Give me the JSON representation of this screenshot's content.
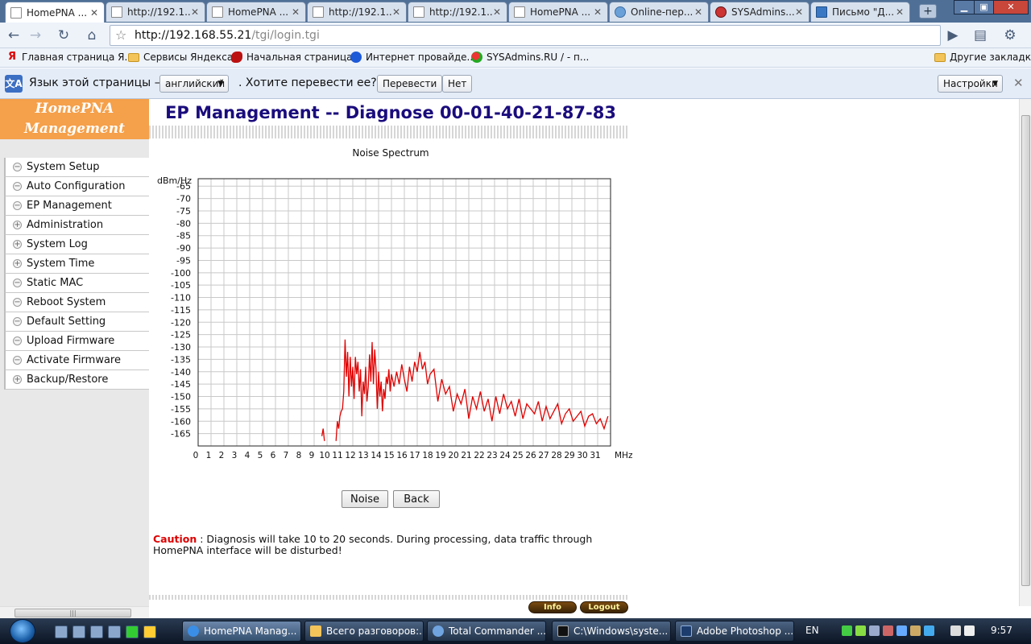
{
  "browser": {
    "tabs": [
      {
        "title": "HomePNA ...",
        "icon": "page-icon",
        "active": true
      },
      {
        "title": "http://192.1...",
        "icon": "page-icon"
      },
      {
        "title": "HomePNA ...",
        "icon": "page-icon"
      },
      {
        "title": "http://192.1...",
        "icon": "page-icon"
      },
      {
        "title": "http://192.1...",
        "icon": "page-icon"
      },
      {
        "title": "HomePNA ...",
        "icon": "page-icon"
      },
      {
        "title": "Online-пер...",
        "icon": "globe-icon"
      },
      {
        "title": "SYSAdmins....",
        "icon": "sysadmins-icon"
      },
      {
        "title": "Письмо \"Д...",
        "icon": "mail-icon"
      }
    ],
    "new_tab": "+",
    "url_host": "http://192.168.55.21",
    "url_path": "/tgi/login.tgi",
    "bookmarks": [
      {
        "label": "Главная страница Я...",
        "icon": "yandex-icon"
      },
      {
        "label": "Сервисы Яндекса",
        "icon": "folder-icon"
      },
      {
        "label": "Начальная страница",
        "icon": "bird-icon"
      },
      {
        "label": "Интернет провайде...",
        "icon": "provider-icon"
      },
      {
        "label": "SYSAdmins.RU / - п...",
        "icon": "sysadmins-icon"
      }
    ],
    "other_bookmarks": "Другие закладки"
  },
  "translate": {
    "prefix": "Язык этой страницы –",
    "language": "английский",
    "question": ". Хотите перевести ее?",
    "translate_btn": "Перевести",
    "no_btn": "Нет",
    "settings_btn": "Настройки"
  },
  "nav": {
    "logo_line1": "HomePNA",
    "logo_line2": "Management",
    "items": [
      {
        "label": "System Setup",
        "sign": "−"
      },
      {
        "label": "Auto Configuration",
        "sign": "−"
      },
      {
        "label": "EP Management",
        "sign": "−"
      },
      {
        "label": "Administration",
        "sign": "+"
      },
      {
        "label": "System Log",
        "sign": "+"
      },
      {
        "label": "System Time",
        "sign": "+"
      },
      {
        "label": "Static MAC",
        "sign": "−"
      },
      {
        "label": "Reboot System",
        "sign": "−"
      },
      {
        "label": "Default Setting",
        "sign": "−"
      },
      {
        "label": "Upload Firmware",
        "sign": "−"
      },
      {
        "label": "Activate Firmware",
        "sign": "−"
      },
      {
        "label": "Backup/Restore",
        "sign": "+"
      }
    ]
  },
  "page": {
    "title": "EP Management -- Diagnose 00-01-40-21-87-83",
    "noise_btn": "Noise",
    "back_btn": "Back",
    "caution_word": "Caution",
    "caution_text": " : Diagnosis will take 10 to 20 seconds. During processing, data traffic through HomePNA interface will be disturbed!",
    "info_btn": "Info",
    "logout_btn": "Logout"
  },
  "chart_data": {
    "type": "line",
    "title": "Noise Spectrum",
    "ylabel": "dBm/Hz",
    "xlabel": "MHz",
    "xlim": [
      0,
      32
    ],
    "ylim": [
      -170,
      -62
    ],
    "yticks": [
      -65,
      -70,
      -75,
      -80,
      -85,
      -90,
      -95,
      -100,
      -105,
      -110,
      -115,
      -120,
      -125,
      -130,
      -135,
      -140,
      -145,
      -150,
      -155,
      -160,
      -165
    ],
    "xticks": [
      0,
      1,
      2,
      3,
      4,
      5,
      6,
      7,
      8,
      9,
      10,
      11,
      12,
      13,
      14,
      15,
      16,
      17,
      18,
      19,
      20,
      21,
      22,
      23,
      24,
      25,
      26,
      27,
      28,
      29,
      30,
      31
    ],
    "grid": true,
    "color": "#e00000",
    "series": [
      {
        "x": [
          9.6,
          9.7,
          9.8,
          10.7,
          10.8,
          10.9,
          11.0,
          11.1,
          11.2,
          11.3,
          11.4,
          11.5,
          11.6,
          11.7,
          11.8,
          11.9,
          12.0,
          12.1,
          12.2,
          12.3,
          12.4,
          12.5,
          12.6,
          12.7,
          12.8,
          12.9,
          13.0,
          13.1,
          13.2,
          13.3,
          13.4,
          13.5,
          13.6,
          13.7,
          13.8,
          13.9,
          14.0,
          14.1,
          14.2,
          14.3,
          14.4,
          14.5,
          14.6,
          14.7,
          14.8,
          14.9,
          15.0,
          15.2,
          15.4,
          15.6,
          15.8,
          16.0,
          16.2,
          16.4,
          16.6,
          16.8,
          17.0,
          17.2,
          17.4,
          17.6,
          17.8,
          18.0,
          18.3,
          18.6,
          18.9,
          19.2,
          19.5,
          19.8,
          20.1,
          20.4,
          20.7,
          21.0,
          21.3,
          21.6,
          21.9,
          22.2,
          22.5,
          22.8,
          23.1,
          23.4,
          23.7,
          24.0,
          24.3,
          24.6,
          24.9,
          25.2,
          25.5,
          25.8,
          26.1,
          26.4,
          26.7,
          27.0,
          27.3,
          27.6,
          27.9,
          28.2,
          28.5,
          28.8,
          29.1,
          29.4,
          29.7,
          30.0,
          30.3,
          30.6,
          30.9,
          31.2,
          31.5,
          31.8
        ],
        "values": [
          -166,
          -163,
          -168,
          -168,
          -160,
          -163,
          -158,
          -156,
          -155,
          -148,
          -127,
          -142,
          -132,
          -150,
          -134,
          -146,
          -138,
          -151,
          -134,
          -141,
          -136,
          -148,
          -139,
          -158,
          -144,
          -149,
          -138,
          -152,
          -146,
          -133,
          -144,
          -128,
          -145,
          -131,
          -139,
          -155,
          -140,
          -150,
          -144,
          -156,
          -147,
          -151,
          -142,
          -145,
          -139,
          -148,
          -141,
          -146,
          -140,
          -145,
          -137,
          -143,
          -148,
          -138,
          -144,
          -136,
          -140,
          -132,
          -139,
          -136,
          -145,
          -141,
          -139,
          -152,
          -143,
          -149,
          -146,
          -156,
          -149,
          -153,
          -147,
          -159,
          -150,
          -155,
          -148,
          -156,
          -151,
          -160,
          -150,
          -157,
          -149,
          -155,
          -152,
          -158,
          -151,
          -159,
          -153,
          -155,
          -157,
          -152,
          -160,
          -154,
          -159,
          -156,
          -153,
          -161,
          -157,
          -155,
          -160,
          -158,
          -156,
          -162,
          -158,
          -157,
          -161,
          -159,
          -163,
          -158
        ]
      }
    ]
  }
}
